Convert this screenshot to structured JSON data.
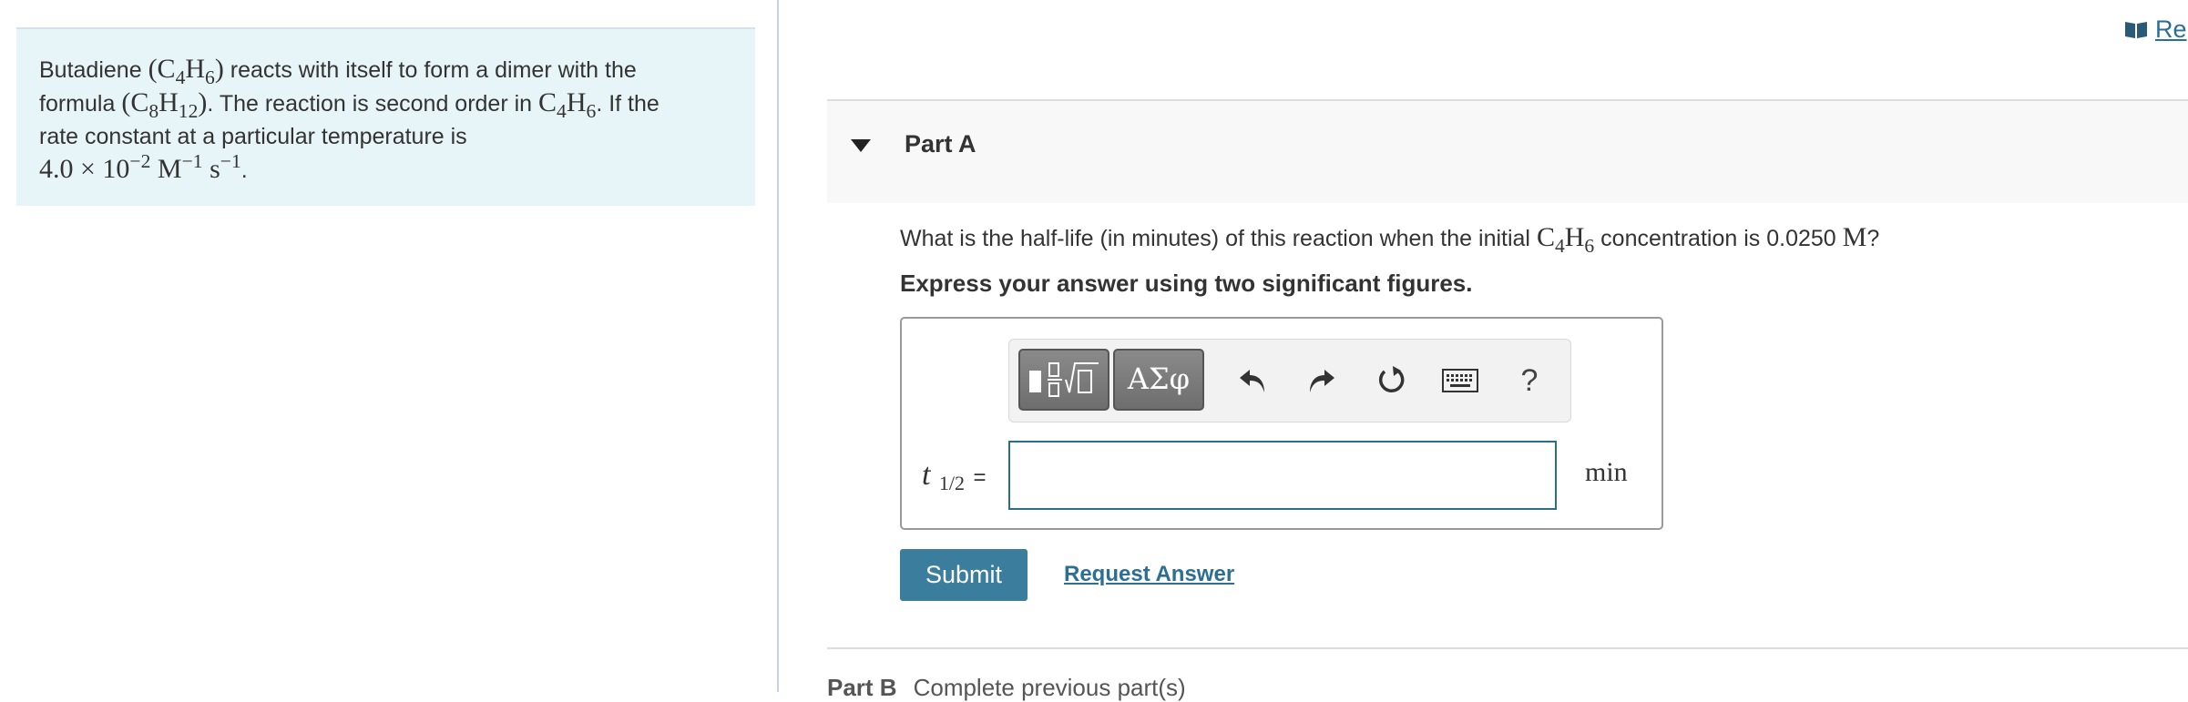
{
  "problem": {
    "intro": "Butadiene",
    "reactant_formula": "(C4H6)",
    "text1": "reacts with itself to form a dimer with the",
    "text2": "formula",
    "dimer_formula": "(C8H12)",
    "text3": ". The reaction is second order in",
    "species": "C4H6",
    "text4": ". If the",
    "text5": "rate constant at a particular temperature is",
    "rate_constant": "4.0 × 10−2 M−1 s−1",
    "period": "."
  },
  "header": {
    "resources_label": "Re"
  },
  "partA": {
    "title": "Part A",
    "question_before": "What is the half-life (in minutes) of this reaction when the initial",
    "question_species": "C4H6",
    "question_after": "concentration is 0.0250",
    "question_unit": "M",
    "question_end": "?",
    "instruction": "Express your answer using two significant figures.",
    "toolbar": {
      "symbols_label": "ΑΣφ",
      "help_label": "?"
    },
    "answer": {
      "label_var": "t",
      "label_sub": "1/2",
      "label_eq": "=",
      "value": "",
      "unit": "min"
    },
    "submit_label": "Submit",
    "request_answer_label": "Request Answer"
  },
  "partB": {
    "title": "Part B",
    "status": "Complete previous part(s)"
  }
}
